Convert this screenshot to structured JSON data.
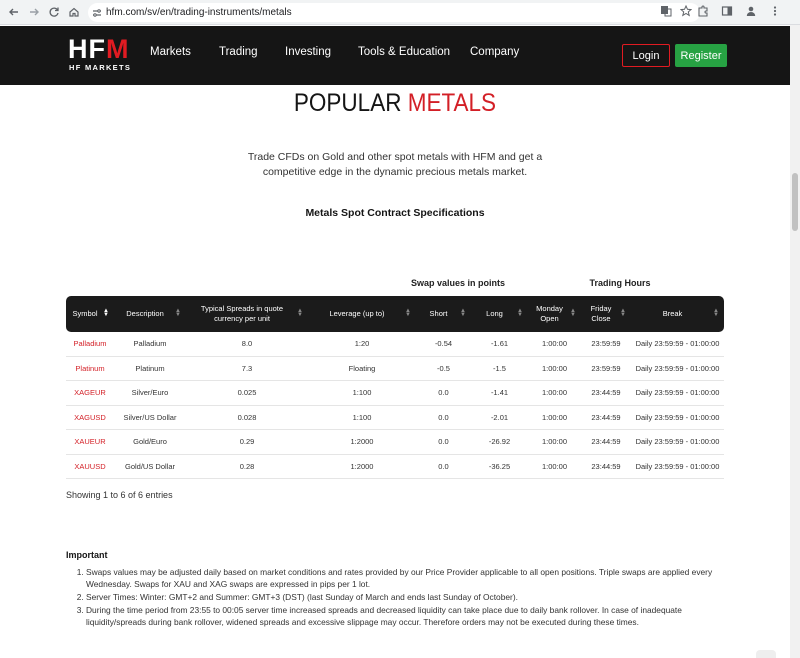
{
  "browser": {
    "url": "hfm.com/sv/en/trading-instruments/metals"
  },
  "header": {
    "logo_main": "HFM",
    "logo_sub": "HF MARKETS",
    "nav": [
      "Markets",
      "Trading",
      "Investing",
      "Tools & Education",
      "Company"
    ],
    "login": "Login",
    "register": "Register"
  },
  "page": {
    "title_part1": "POPULAR ",
    "title_part2": "METALS",
    "intro": "Trade CFDs on Gold and other spot metals with HFM and get a competitive edge in the dynamic precious metals market.",
    "spec_title": "Metals Spot Contract Specifications",
    "group_swap": "Swap values in points",
    "group_hours": "Trading Hours"
  },
  "table": {
    "headers": [
      "Symbol",
      "Description",
      "Typical Spreads in quote currency per unit",
      "Leverage (up to)",
      "Short",
      "Long",
      "Monday Open",
      "Friday Close",
      "Break"
    ],
    "rows": [
      [
        "Palladium",
        "Palladium",
        "8.0",
        "1:20",
        "-0.54",
        "-1.61",
        "1:00:00",
        "23:59:59",
        "Daily 23:59:59 - 01:00:00"
      ],
      [
        "Platinum",
        "Platinum",
        "7.3",
        "Floating",
        "-0.5",
        "-1.5",
        "1:00:00",
        "23:59:59",
        "Daily 23:59:59 - 01:00:00"
      ],
      [
        "XAGEUR",
        "Silver/Euro",
        "0.025",
        "1:100",
        "0.0",
        "-1.41",
        "1:00:00",
        "23:44:59",
        "Daily 23:59:59 - 01:00:00"
      ],
      [
        "XAGUSD",
        "Silver/US Dollar",
        "0.028",
        "1:100",
        "0.0",
        "-2.01",
        "1:00:00",
        "23:44:59",
        "Daily 23:59:59 - 01:00:00"
      ],
      [
        "XAUEUR",
        "Gold/Euro",
        "0.29",
        "1:2000",
        "0.0",
        "-26.92",
        "1:00:00",
        "23:44:59",
        "Daily 23:59:59 - 01:00:00"
      ],
      [
        "XAUUSD",
        "Gold/US Dollar",
        "0.28",
        "1:2000",
        "0.0",
        "-36.25",
        "1:00:00",
        "23:44:59",
        "Daily 23:59:59 - 01:00:00"
      ]
    ],
    "info": "Showing 1 to 6 of 6 entries"
  },
  "important": {
    "heading": "Important",
    "notes": [
      "Swaps values may be adjusted daily based on market conditions and rates provided by our Price Provider applicable to all open positions. Triple swaps are applied every Wednesday. Swaps for XAU and XAG swaps are expressed in pips per 1 lot.",
      "Server Times: Winter: GMT+2 and Summer: GMT+3 (DST) (last Sunday of March and ends last Sunday of October).",
      "During the time period from 23:55 to 00:05 server time increased spreads and decreased liquidity can take place due to daily bank rollover. In case of inadequate liquidity/spreads during bank rollover, widened spreads and excessive slippage may occur. Therefore orders may not be executed during these times."
    ]
  },
  "colors": {
    "accent_red": "#d31f26",
    "register_green": "#27a243",
    "header_bg": "#151515"
  }
}
